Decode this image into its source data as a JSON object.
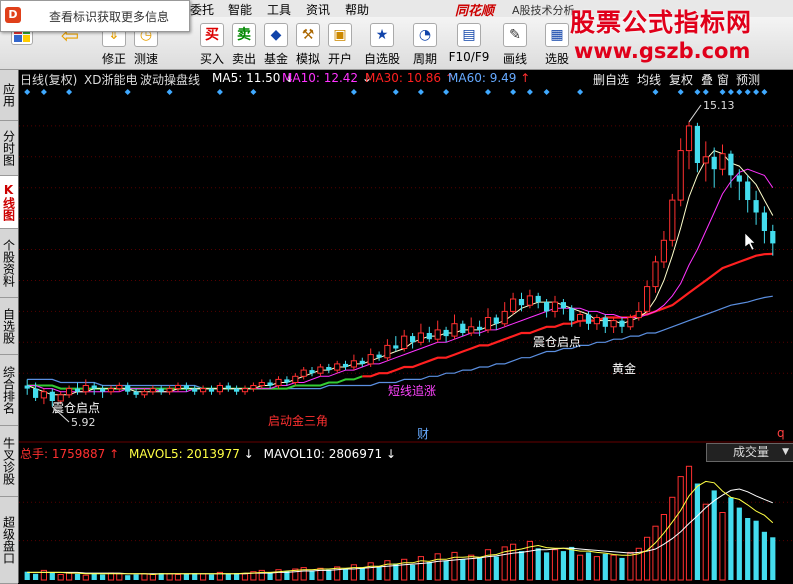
{
  "tip": {
    "text": "查看标识获取更多信息",
    "logo": "D"
  },
  "menu": [
    "委托",
    "智能",
    "工具",
    "资讯",
    "帮助"
  ],
  "app": {
    "brand": "同花顺",
    "subtitle": "A股技术分析"
  },
  "watermark": {
    "title": "股票公式指标网",
    "url": "www.gszb.com"
  },
  "toolbar": [
    {
      "label": "",
      "icon": "windows-icon"
    },
    {
      "label": "",
      "icon": "back-arrow-icon",
      "glyph": "⇦"
    },
    {
      "label": "修正",
      "icon": "up-down-icon",
      "glyph": "⇕"
    },
    {
      "label": "测速",
      "icon": "clock-icon",
      "glyph": "◷"
    },
    {
      "label": "买入",
      "icon": "buy-icon",
      "glyph": "买"
    },
    {
      "label": "卖出",
      "icon": "sell-icon",
      "glyph": "卖"
    },
    {
      "label": "基金",
      "icon": "fund-icon",
      "glyph": "◆"
    },
    {
      "label": "模拟",
      "icon": "hammer-icon",
      "glyph": "⚒"
    },
    {
      "label": "开户",
      "icon": "lock-icon",
      "glyph": "▣"
    },
    {
      "label": "自选股",
      "icon": "star-icon",
      "glyph": "★"
    },
    {
      "label": "周期",
      "icon": "period-icon",
      "glyph": "◔"
    },
    {
      "label": "F10/F9",
      "icon": "f10-icon",
      "glyph": "▤"
    },
    {
      "label": "画线",
      "icon": "pen-icon",
      "glyph": "✎"
    },
    {
      "label": "选股",
      "icon": "select-stock-icon",
      "glyph": "▦"
    }
  ],
  "leftnav": [
    {
      "label": "应用",
      "active": false
    },
    {
      "label": "分时图",
      "active": false
    },
    {
      "label": "K线图",
      "active": true
    },
    {
      "label": "个股资料",
      "active": false
    },
    {
      "label": "自选股",
      "active": false
    },
    {
      "label": "综合排名",
      "active": false
    },
    {
      "label": "牛叉诊股",
      "active": false
    },
    {
      "label": "超级盘口",
      "active": false
    }
  ],
  "chart_header": {
    "period": "日线(复权)",
    "stock": "XD浙能电",
    "indicator": "波动操盘线",
    "ma": [
      {
        "label": "MA5:",
        "value": "11.50",
        "dir": "down",
        "color": "#ffffff"
      },
      {
        "label": "MA10:",
        "value": "12.42",
        "dir": "down",
        "color": "#ff33ff"
      },
      {
        "label": "MA30:",
        "value": "10.86",
        "dir": "up",
        "color": "#ff2020"
      },
      {
        "label": "MA60:",
        "value": "9.49",
        "dir": "up",
        "color": "#66aaff"
      }
    ]
  },
  "view_tabs": [
    "删自选",
    "均线",
    "复权",
    "叠",
    "窗",
    "预测"
  ],
  "annotations": {
    "high": "15.13",
    "low": "5.92",
    "labels": [
      {
        "text": "震仓启点",
        "color": "#ffffff"
      },
      {
        "text": "启动金三角",
        "color": "#ff3030"
      },
      {
        "text": "短线追涨",
        "color": "#ff44ff"
      },
      {
        "text": "震仓启点",
        "color": "#ffffff"
      },
      {
        "text": "黄金",
        "color": "#ffffff"
      },
      {
        "text": "财",
        "color": "#66aaff"
      },
      {
        "text": "q",
        "color": "#ff4040"
      }
    ]
  },
  "volume_header": {
    "total_label": "总手:",
    "total_value": "1759887",
    "total_dir": "up",
    "mavol5_label": "MAVOL5:",
    "mavol5_value": "2013977",
    "mavol5_dir": "down",
    "mavol10_label": "MAVOL10:",
    "mavol10_value": "2806971",
    "mavol10_dir": "down",
    "selector": "成交量",
    "selector_arrow": "▼"
  },
  "colors": {
    "up": "#ff3030",
    "down": "#44ddee",
    "background": "#000000",
    "grid": "#550000"
  },
  "chart_data": {
    "type": "candlestick",
    "ylim": [
      5,
      16
    ],
    "candles": [
      [
        6.6,
        6.5,
        6.8,
        6.3
      ],
      [
        6.5,
        6.2,
        6.7,
        6.1
      ],
      [
        6.2,
        6.4,
        6.5,
        6.0
      ],
      [
        6.4,
        6.1,
        6.5,
        5.92
      ],
      [
        6.1,
        6.3,
        6.4,
        6.0
      ],
      [
        6.3,
        6.5,
        6.6,
        6.2
      ],
      [
        6.5,
        6.4,
        6.7,
        6.3
      ],
      [
        6.4,
        6.6,
        6.8,
        6.3
      ],
      [
        6.6,
        6.5,
        6.7,
        6.3
      ],
      [
        6.5,
        6.4,
        6.6,
        6.2
      ],
      [
        6.4,
        6.5,
        6.6,
        6.3
      ],
      [
        6.5,
        6.6,
        6.7,
        6.4
      ],
      [
        6.6,
        6.4,
        6.7,
        6.3
      ],
      [
        6.4,
        6.3,
        6.5,
        6.2
      ],
      [
        6.3,
        6.4,
        6.5,
        6.2
      ],
      [
        6.4,
        6.5,
        6.6,
        6.3
      ],
      [
        6.5,
        6.4,
        6.6,
        6.3
      ],
      [
        6.4,
        6.5,
        6.6,
        6.3
      ],
      [
        6.5,
        6.6,
        6.7,
        6.4
      ],
      [
        6.6,
        6.5,
        6.7,
        6.4
      ],
      [
        6.5,
        6.4,
        6.6,
        6.3
      ],
      [
        6.4,
        6.5,
        6.6,
        6.3
      ],
      [
        6.5,
        6.4,
        6.6,
        6.3
      ],
      [
        6.4,
        6.6,
        6.7,
        6.3
      ],
      [
        6.6,
        6.5,
        6.7,
        6.4
      ],
      [
        6.5,
        6.4,
        6.6,
        6.3
      ],
      [
        6.4,
        6.5,
        6.6,
        6.3
      ],
      [
        6.5,
        6.6,
        6.7,
        6.4
      ],
      [
        6.6,
        6.7,
        6.8,
        6.5
      ],
      [
        6.7,
        6.6,
        6.8,
        6.5
      ],
      [
        6.6,
        6.8,
        6.9,
        6.5
      ],
      [
        6.8,
        6.7,
        6.9,
        6.6
      ],
      [
        6.7,
        6.9,
        7.0,
        6.6
      ],
      [
        6.9,
        7.1,
        7.2,
        6.8
      ],
      [
        7.1,
        7.0,
        7.2,
        6.9
      ],
      [
        7.0,
        7.2,
        7.3,
        6.9
      ],
      [
        7.2,
        7.1,
        7.3,
        7.0
      ],
      [
        7.1,
        7.3,
        7.4,
        7.0
      ],
      [
        7.3,
        7.2,
        7.4,
        7.1
      ],
      [
        7.2,
        7.4,
        7.6,
        7.1
      ],
      [
        7.4,
        7.3,
        7.5,
        7.2
      ],
      [
        7.3,
        7.6,
        7.8,
        7.2
      ],
      [
        7.6,
        7.5,
        7.7,
        7.4
      ],
      [
        7.5,
        7.9,
        8.1,
        7.4
      ],
      [
        7.9,
        7.8,
        8.2,
        7.7
      ],
      [
        7.8,
        8.2,
        8.4,
        7.7
      ],
      [
        8.2,
        8.0,
        8.3,
        7.8
      ],
      [
        8.0,
        8.3,
        8.6,
        7.9
      ],
      [
        8.3,
        8.1,
        8.5,
        8.0
      ],
      [
        8.1,
        8.4,
        8.7,
        8.0
      ],
      [
        8.4,
        8.2,
        8.5,
        8.0
      ],
      [
        8.2,
        8.6,
        8.9,
        8.1
      ],
      [
        8.6,
        8.3,
        8.7,
        8.2
      ],
      [
        8.3,
        8.5,
        8.8,
        8.2
      ],
      [
        8.5,
        8.4,
        8.7,
        8.2
      ],
      [
        8.4,
        8.8,
        9.1,
        8.3
      ],
      [
        8.8,
        8.6,
        8.9,
        8.4
      ],
      [
        8.6,
        9.0,
        9.3,
        8.5
      ],
      [
        9.0,
        9.4,
        9.6,
        8.9
      ],
      [
        9.4,
        9.2,
        9.6,
        9.0
      ],
      [
        9.2,
        9.5,
        9.7,
        9.1
      ],
      [
        9.5,
        9.3,
        9.6,
        9.1
      ],
      [
        9.3,
        9.0,
        9.4,
        8.8
      ],
      [
        9.0,
        9.3,
        9.5,
        8.8
      ],
      [
        9.3,
        9.1,
        9.4,
        8.9
      ],
      [
        9.1,
        8.7,
        9.2,
        8.5
      ],
      [
        8.7,
        8.9,
        9.0,
        8.5
      ],
      [
        8.9,
        8.6,
        9.0,
        8.4
      ],
      [
        8.6,
        8.8,
        8.9,
        8.4
      ],
      [
        8.8,
        8.5,
        8.9,
        8.3
      ],
      [
        8.5,
        8.7,
        8.8,
        8.3
      ],
      [
        8.7,
        8.5,
        8.8,
        8.3
      ],
      [
        8.5,
        8.8,
        8.9,
        8.4
      ],
      [
        8.8,
        9.0,
        9.3,
        8.7
      ],
      [
        9.0,
        9.8,
        10.0,
        8.9
      ],
      [
        9.8,
        10.6,
        10.8,
        9.6
      ],
      [
        10.6,
        11.3,
        11.6,
        10.4
      ],
      [
        11.3,
        12.6,
        12.8,
        11.1
      ],
      [
        12.6,
        14.2,
        14.6,
        12.4
      ],
      [
        14.2,
        15.0,
        15.13,
        13.6
      ],
      [
        15.0,
        13.8,
        15.1,
        13.5
      ],
      [
        13.8,
        14.0,
        14.5,
        13.2
      ],
      [
        14.0,
        13.6,
        14.3,
        13.0
      ],
      [
        13.6,
        14.1,
        14.4,
        13.4
      ],
      [
        14.1,
        13.4,
        14.2,
        13.0
      ],
      [
        13.4,
        13.2,
        13.6,
        12.6
      ],
      [
        13.2,
        12.6,
        13.4,
        12.2
      ],
      [
        12.6,
        12.2,
        12.9,
        11.8
      ],
      [
        12.2,
        11.6,
        12.4,
        11.2
      ],
      [
        11.6,
        11.2,
        11.8,
        10.8
      ]
    ],
    "ma5": [
      6.6,
      6.5,
      6.4,
      6.3,
      6.3,
      6.3,
      6.4,
      6.4,
      6.5,
      6.5,
      6.5,
      6.5,
      6.5,
      6.4,
      6.4,
      6.4,
      6.4,
      6.4,
      6.5,
      6.5,
      6.5,
      6.5,
      6.5,
      6.5,
      6.5,
      6.5,
      6.5,
      6.5,
      6.6,
      6.6,
      6.7,
      6.7,
      6.8,
      6.9,
      7.0,
      7.1,
      7.1,
      7.2,
      7.2,
      7.3,
      7.3,
      7.4,
      7.5,
      7.6,
      7.7,
      7.8,
      8.0,
      8.1,
      8.2,
      8.2,
      8.3,
      8.3,
      8.4,
      8.4,
      8.4,
      8.5,
      8.6,
      8.7,
      8.9,
      9.1,
      9.2,
      9.3,
      9.3,
      9.3,
      9.2,
      9.1,
      9.0,
      8.9,
      8.7,
      8.7,
      8.7,
      8.6,
      8.7,
      8.8,
      9.0,
      9.4,
      10.0,
      10.8,
      11.7,
      12.7,
      13.4,
      13.9,
      14.2,
      14.1,
      13.8,
      13.7,
      13.4,
      13.1,
      12.6,
      12.1
    ],
    "ma10": [
      6.6,
      6.6,
      6.5,
      6.5,
      6.4,
      6.4,
      6.4,
      6.4,
      6.4,
      6.4,
      6.4,
      6.4,
      6.5,
      6.5,
      6.5,
      6.5,
      6.4,
      6.4,
      6.4,
      6.4,
      6.5,
      6.5,
      6.5,
      6.5,
      6.5,
      6.5,
      6.5,
      6.5,
      6.5,
      6.5,
      6.6,
      6.6,
      6.7,
      6.7,
      6.8,
      6.9,
      6.9,
      7.0,
      7.1,
      7.1,
      7.2,
      7.3,
      7.3,
      7.4,
      7.5,
      7.6,
      7.7,
      7.8,
      7.9,
      8.0,
      8.0,
      8.1,
      8.2,
      8.3,
      8.3,
      8.4,
      8.4,
      8.5,
      8.6,
      8.7,
      8.8,
      8.9,
      9.0,
      9.1,
      9.1,
      9.1,
      9.1,
      9.0,
      9.0,
      8.9,
      8.9,
      8.8,
      8.8,
      8.8,
      8.9,
      9.0,
      9.2,
      9.5,
      9.9,
      10.5,
      11.0,
      11.6,
      12.2,
      12.8,
      13.2,
      13.5,
      13.6,
      13.5,
      13.4,
      13.0
    ],
    "ma30": [
      6.6,
      6.6,
      6.6,
      6.6,
      6.5,
      6.5,
      6.5,
      6.5,
      6.5,
      6.5,
      6.5,
      6.5,
      6.5,
      6.5,
      6.5,
      6.5,
      6.5,
      6.5,
      6.5,
      6.5,
      6.5,
      6.5,
      6.5,
      6.5,
      6.5,
      6.5,
      6.5,
      6.5,
      6.5,
      6.5,
      6.5,
      6.5,
      6.6,
      6.6,
      6.6,
      6.6,
      6.7,
      6.7,
      6.8,
      6.8,
      6.9,
      6.9,
      7.0,
      7.0,
      7.1,
      7.2,
      7.2,
      7.3,
      7.4,
      7.5,
      7.5,
      7.6,
      7.7,
      7.8,
      7.9,
      7.9,
      8.0,
      8.1,
      8.2,
      8.3,
      8.3,
      8.4,
      8.5,
      8.5,
      8.6,
      8.6,
      8.7,
      8.7,
      8.7,
      8.8,
      8.8,
      8.8,
      8.8,
      8.9,
      8.9,
      9.0,
      9.1,
      9.2,
      9.4,
      9.6,
      9.8,
      10.0,
      10.2,
      10.4,
      10.5,
      10.6,
      10.7,
      10.8,
      10.85,
      10.86
    ],
    "ma60": [
      6.8,
      6.8,
      6.8,
      6.8,
      6.7,
      6.7,
      6.7,
      6.7,
      6.7,
      6.6,
      6.6,
      6.6,
      6.6,
      6.6,
      6.6,
      6.6,
      6.6,
      6.6,
      6.6,
      6.6,
      6.6,
      6.5,
      6.5,
      6.5,
      6.5,
      6.5,
      6.5,
      6.5,
      6.5,
      6.5,
      6.5,
      6.5,
      6.5,
      6.5,
      6.5,
      6.5,
      6.6,
      6.6,
      6.6,
      6.6,
      6.6,
      6.6,
      6.7,
      6.7,
      6.7,
      6.8,
      6.8,
      6.8,
      6.9,
      6.9,
      7.0,
      7.0,
      7.1,
      7.1,
      7.2,
      7.2,
      7.3,
      7.3,
      7.4,
      7.5,
      7.5,
      7.6,
      7.7,
      7.7,
      7.8,
      7.8,
      7.9,
      7.9,
      8.0,
      8.0,
      8.1,
      8.1,
      8.2,
      8.2,
      8.3,
      8.3,
      8.4,
      8.5,
      8.6,
      8.7,
      8.8,
      8.9,
      9.0,
      9.1,
      9.2,
      9.25,
      9.3,
      9.38,
      9.45,
      9.49
    ],
    "volume": [
      12,
      9,
      14,
      11,
      8,
      10,
      9,
      7,
      9,
      8,
      10,
      9,
      7,
      8,
      9,
      8,
      10,
      9,
      8,
      9,
      10,
      9,
      8,
      11,
      9,
      10,
      9,
      12,
      14,
      11,
      15,
      13,
      16,
      18,
      14,
      17,
      15,
      19,
      16,
      22,
      18,
      25,
      20,
      28,
      24,
      30,
      22,
      34,
      26,
      38,
      28,
      40,
      30,
      36,
      32,
      44,
      34,
      48,
      52,
      42,
      56,
      46,
      40,
      44,
      42,
      48,
      36,
      40,
      34,
      38,
      36,
      32,
      40,
      46,
      62,
      78,
      95,
      120,
      150,
      165,
      140,
      110,
      130,
      98,
      120,
      105,
      90,
      86,
      70,
      62
    ],
    "mavol5": [
      11,
      11,
      11,
      11,
      11,
      10,
      10,
      9,
      9,
      9,
      9,
      9,
      9,
      9,
      9,
      8,
      9,
      9,
      9,
      9,
      9,
      9,
      9,
      9,
      9,
      9,
      10,
      10,
      11,
      11,
      12,
      13,
      14,
      15,
      15,
      16,
      16,
      17,
      17,
      18,
      18,
      20,
      20,
      23,
      23,
      25,
      25,
      28,
      27,
      30,
      30,
      33,
      33,
      34,
      33,
      36,
      37,
      41,
      43,
      45,
      48,
      50,
      47,
      46,
      46,
      44,
      42,
      42,
      40,
      39,
      37,
      36,
      36,
      38,
      43,
      54,
      68,
      84,
      101,
      122,
      136,
      143,
      141,
      129,
      120,
      117,
      109,
      100,
      94,
      83
    ],
    "mavol10": [
      11,
      11,
      11,
      11,
      11,
      11,
      11,
      10,
      10,
      10,
      10,
      10,
      9,
      9,
      9,
      9,
      9,
      9,
      9,
      9,
      9,
      9,
      9,
      9,
      9,
      9,
      9,
      10,
      10,
      10,
      11,
      11,
      12,
      13,
      13,
      14,
      14,
      15,
      16,
      16,
      17,
      18,
      19,
      20,
      21,
      22,
      23,
      24,
      25,
      27,
      28,
      29,
      30,
      31,
      32,
      34,
      35,
      37,
      39,
      40,
      42,
      44,
      44,
      45,
      46,
      46,
      45,
      44,
      43,
      42,
      41,
      40,
      39,
      40,
      42,
      45,
      52,
      60,
      70,
      82,
      93,
      105,
      115,
      123,
      130,
      132,
      128,
      122,
      117,
      112
    ]
  }
}
